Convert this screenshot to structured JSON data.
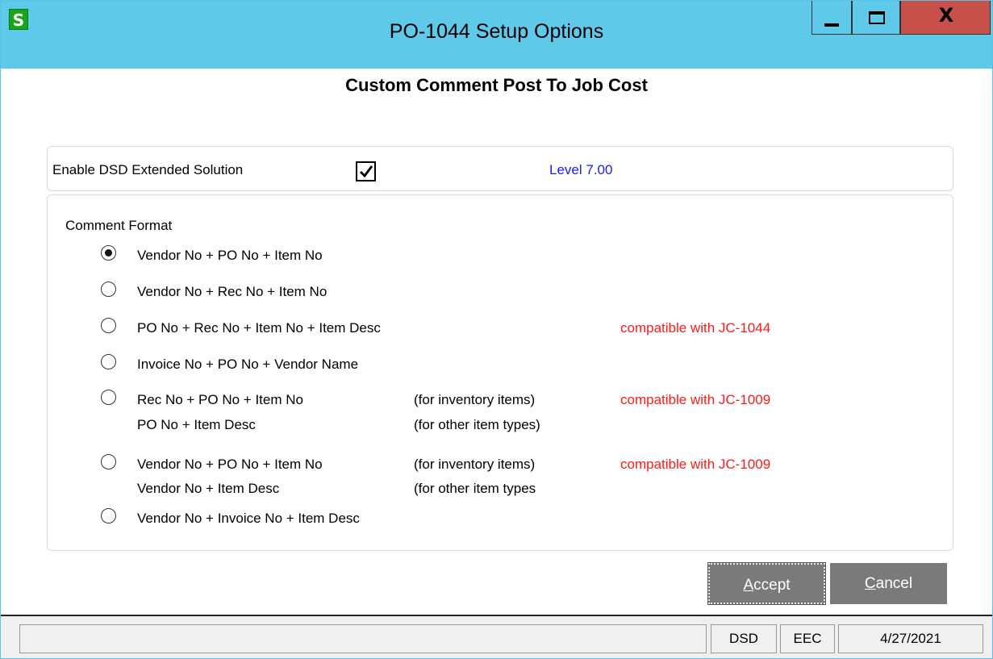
{
  "window": {
    "title": "PO-1044 Setup Options",
    "app_icon_letter": "S",
    "close_glyph": "X"
  },
  "heading": "Custom Comment Post To Job Cost",
  "enable": {
    "label": "Enable DSD Extended Solution",
    "checked": true,
    "level": "Level  7.00"
  },
  "comment_format": {
    "label": "Comment Format",
    "options": [
      {
        "line1": "Vendor No + PO No + Item No",
        "selected": true
      },
      {
        "line1": "Vendor No + Rec No + Item No",
        "selected": false
      },
      {
        "line1": "PO No + Rec No + Item No + Item Desc",
        "note": "compatible with JC-1044",
        "selected": false
      },
      {
        "line1": "Invoice No + PO No + Vendor Name",
        "selected": false
      },
      {
        "line1": "Rec No + PO No + Item No",
        "qual1": "(for inventory items)",
        "line2": "PO No + Item Desc",
        "qual2": "(for other item types)",
        "note": "compatible with JC-1009",
        "selected": false
      },
      {
        "line1": "Vendor No + PO No + Item No",
        "qual1": "(for inventory items)",
        "line2": "Vendor No + Item Desc",
        "qual2": "(for other item types",
        "note": "compatible with JC-1009",
        "selected": false
      },
      {
        "line1": "Vendor No + Invoice No + Item Desc",
        "selected": false
      }
    ]
  },
  "buttons": {
    "accept_mnemonic": "A",
    "accept_rest": "ccept",
    "cancel_mnemonic": "C",
    "cancel_rest": "ancel"
  },
  "statusbar": {
    "message": "",
    "company_code": "DSD",
    "module": "EEC",
    "date": "4/27/2021"
  },
  "colors": {
    "titlebar": "#5fc9ea",
    "close_button": "#c7504a",
    "level_text": "#1a1aff",
    "note_text": "#ff1a1a",
    "button_bg": "#7a7a7a"
  }
}
